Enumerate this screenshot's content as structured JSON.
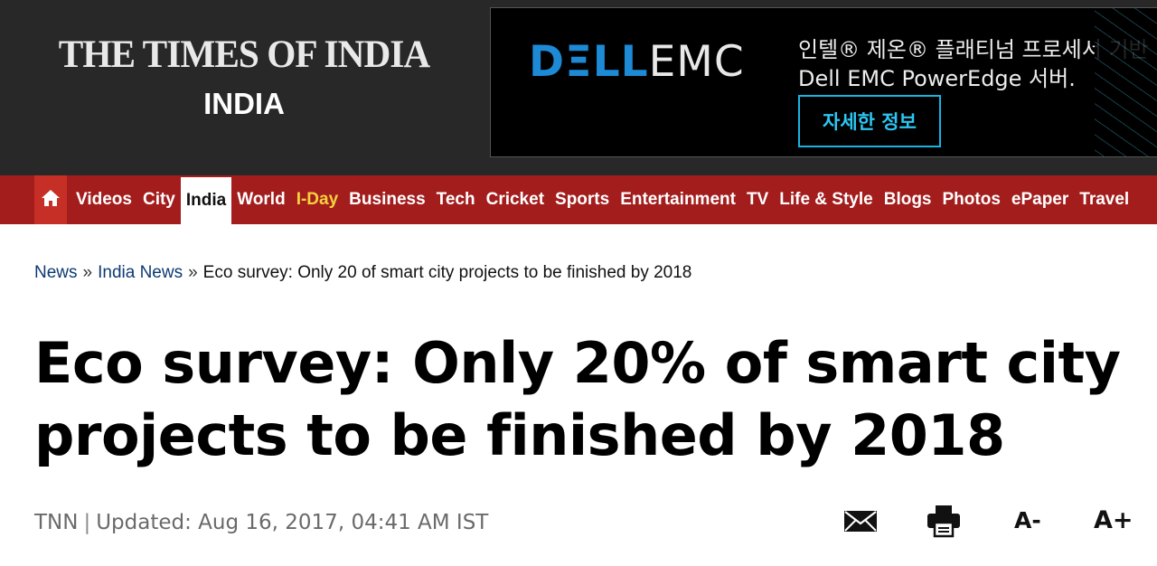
{
  "header": {
    "logo": "THE TIMES OF INDIA",
    "edition": "INDIA"
  },
  "ad": {
    "brand_part1": "DΞLL",
    "brand_part2": "EMC",
    "line1": "인텔® 제온® 플래티넘 프로세서 기반",
    "line2": "Dell EMC PowerEdge 서버.",
    "cta": "자세한 정보"
  },
  "nav": {
    "home_icon": "home-icon",
    "items": [
      "Videos",
      "City",
      "India",
      "World",
      "I-Day",
      "Business",
      "Tech",
      "Cricket",
      "Sports",
      "Entertainment",
      "TV",
      "Life & Style",
      "Blogs",
      "Photos",
      "ePaper",
      "Travel"
    ],
    "active": "India",
    "highlight": "I-Day"
  },
  "breadcrumb": {
    "items": [
      "News",
      "India News"
    ],
    "separator": "»",
    "current": "Eco survey: Only 20 of smart city projects to be finished by 2018"
  },
  "article": {
    "headline": "Eco survey: Only 20% of smart city projects to be finished by 2018",
    "source": "TNN",
    "updated": "Updated: Aug 16, 2017, 04:41 AM IST"
  },
  "tools": {
    "mail_icon": "mail-icon",
    "print_icon": "printer-icon",
    "font_decrease": "A-",
    "font_increase": "A+"
  },
  "colors": {
    "header_bg": "#282828",
    "nav_bg": "#a31d1d",
    "home_bg": "#c62f26",
    "highlight": "#f6d23e",
    "link": "#0d3a72",
    "ad_accent": "#18b4e0"
  }
}
